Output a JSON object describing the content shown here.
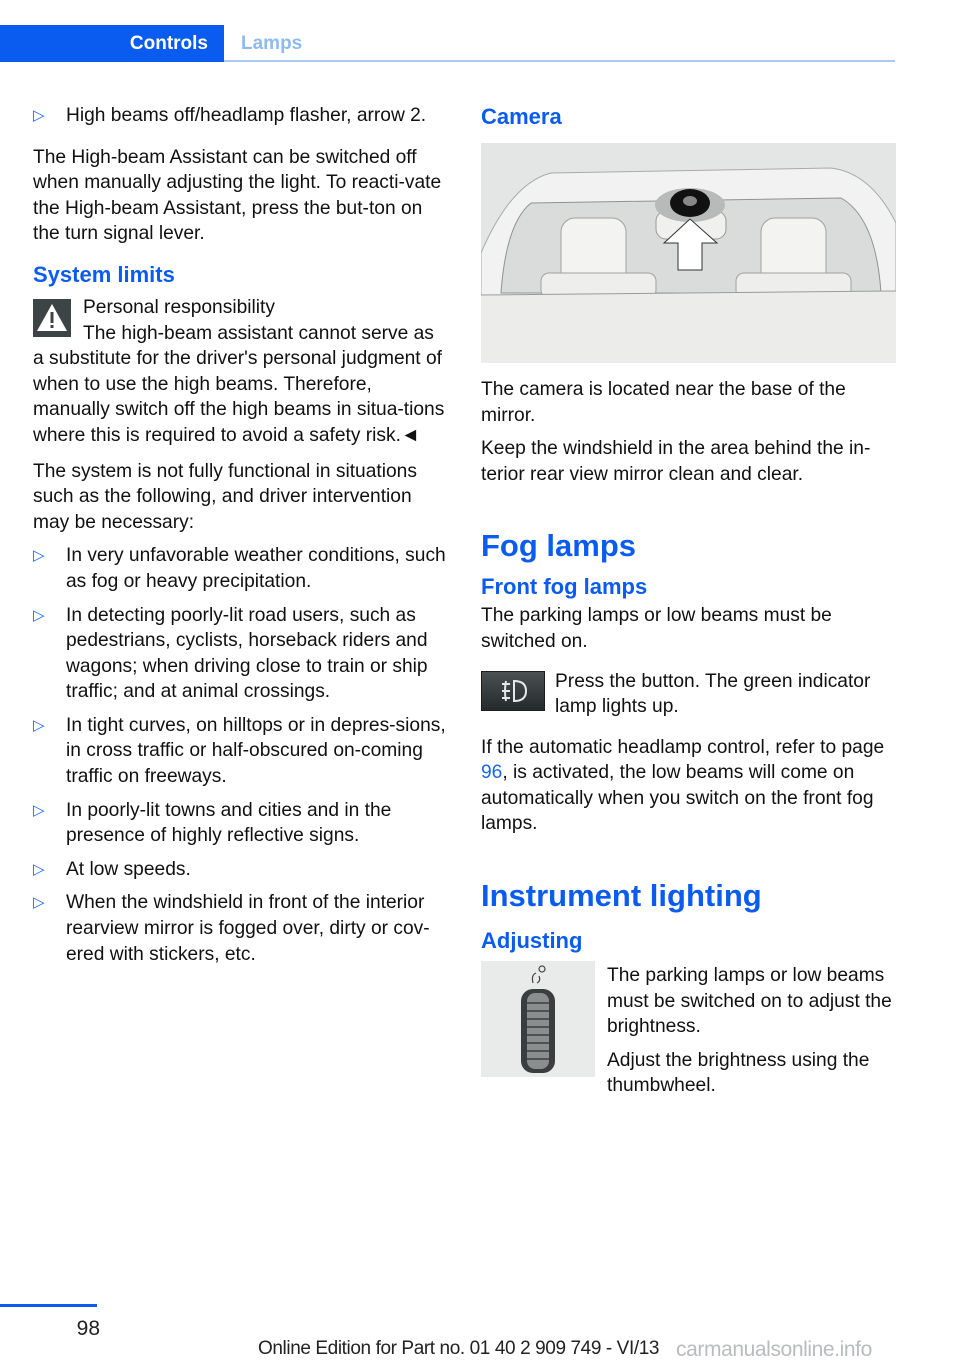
{
  "header": {
    "tabs": [
      {
        "label": "Controls",
        "active": true
      },
      {
        "label": "Lamps",
        "active": false
      }
    ]
  },
  "left_column": {
    "bullet_top": "High beams off/headlamp flasher, arrow 2.",
    "intro_paragraph": "The High-beam Assistant can be switched off when manually adjusting the light. To reacti-vate the High-beam Assistant, press the but-ton on the turn signal lever.",
    "system_limits": {
      "heading": "System limits",
      "warning": {
        "icon": "warning-triangle-icon",
        "title": "Personal responsibility",
        "body": "The high-beam assistant cannot serve as a substitute for the driver's personal judgment of when to use the high beams. Therefore, manually switch off the high beams in situa-tions where this is required to avoid a safety risk.◄"
      },
      "intro": "The system is not fully functional in situations such as the following, and driver intervention may be necessary:",
      "bullets": [
        "In very unfavorable weather conditions, such as fog or heavy precipitation.",
        "In detecting poorly-lit road users, such as pedestrians, cyclists, horseback riders and wagons; when driving close to train or ship traffic; and at animal crossings.",
        "In tight curves, on hilltops or in depres-sions, in cross traffic or half-obscured on-coming traffic on freeways.",
        "In poorly-lit towns and cities and in the presence of highly reflective signs.",
        "At low speeds.",
        "When the windshield in front of the interior rearview mirror is fogged over, dirty or cov-ered with stickers, etc."
      ]
    },
    "bullet_glyph": "▷"
  },
  "right_column": {
    "camera": {
      "heading": "Camera",
      "image": "windshield-camera-illustration",
      "paragraphs": [
        "The camera is located near the base of the mirror.",
        "Keep the windshield in the area behind the in-terior rear view mirror clean and clear."
      ]
    },
    "fog_lamps": {
      "heading": "Fog lamps",
      "subheading": "Front fog lamps",
      "paragraph": "The parking lamps or low beams must be switched on.",
      "button_icon": "front-fog-lamp-icon",
      "button_text": "Press the button. The green indicator lamp lights up.",
      "note_before": "If the automatic headlamp control, refer to page ",
      "note_link": "96",
      "note_after": ", is activated, the low beams will come on automatically when you switch on the front fog lamps."
    },
    "instrument_lighting": {
      "heading": "Instrument lighting",
      "subheading": "Adjusting",
      "image": "thumbwheel-illustration",
      "paragraphs": [
        "The parking lamps or low beams must be switched on to adjust the brightness.",
        "Adjust the brightness using the thumbwheel."
      ]
    }
  },
  "footer": {
    "page_number": "98",
    "edition": "Online Edition for Part no. 01 40 2 909 749 - VI/13",
    "watermark": "carmanualsonline.info"
  },
  "colors": {
    "accent": "#0a5cf0",
    "inactive_tab": "#8fbaf0",
    "link": "#1a66ee"
  }
}
